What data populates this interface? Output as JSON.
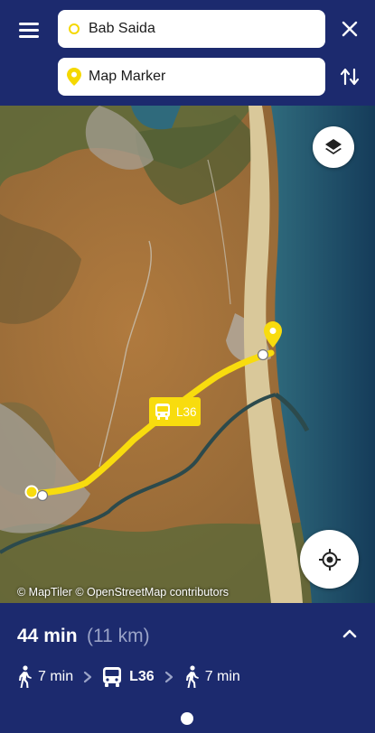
{
  "search": {
    "origin_value": "Bab Saida",
    "destination_value": "Map Marker"
  },
  "icons": {
    "menu": "menu-icon",
    "close": "close-icon",
    "swap": "swap-icon",
    "origin": "ring-icon",
    "destination": "pin-icon",
    "layers": "layers-icon",
    "locate": "crosshair-icon",
    "walk": "walk-icon",
    "bus": "bus-icon",
    "expand": "chevron-up-icon"
  },
  "map": {
    "route_line": "L36",
    "attribution": "© MapTiler © OpenStreetMap contributors",
    "route_color": "#f8dc0e"
  },
  "summary": {
    "duration": "44 min",
    "distance": "(11 km)",
    "steps": [
      {
        "mode": "walk",
        "label": "7 min"
      },
      {
        "mode": "bus",
        "label": "L36"
      },
      {
        "mode": "walk",
        "label": "7 min"
      }
    ]
  },
  "colors": {
    "primary": "#1c2a6e",
    "accent": "#f5d800"
  }
}
